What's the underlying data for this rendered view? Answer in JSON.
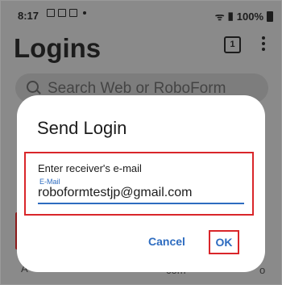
{
  "status_bar": {
    "time": "8:17",
    "battery": "100%"
  },
  "header": {
    "title": "Logins",
    "tab_count": "1"
  },
  "search": {
    "placeholder": "Search Web or RoboForm"
  },
  "background": {
    "label_a": "A",
    "label_com": "com",
    "label_o": "o"
  },
  "dialog": {
    "title": "Send Login",
    "field_label": "Enter receiver's e-mail",
    "field_caption": "E-Mail",
    "field_value": "roboformtestjp@gmail.com",
    "cancel_label": "Cancel",
    "ok_label": "OK"
  },
  "colors": {
    "accent": "#2e6cc0",
    "highlight": "#d9262a",
    "scrim": "#8a8a8a"
  }
}
